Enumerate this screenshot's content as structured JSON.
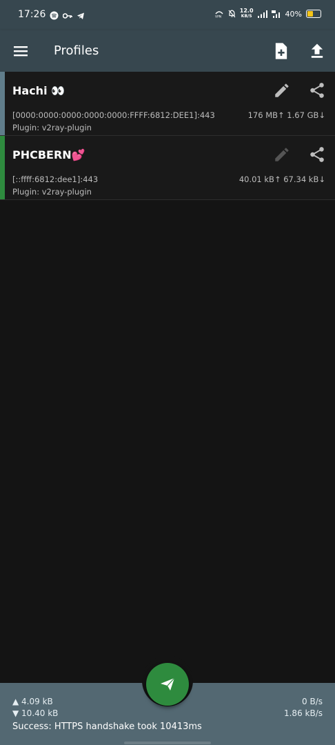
{
  "status_bar": {
    "time": "17:26",
    "net_speed_value": "12.0",
    "net_speed_unit": "KB/S",
    "battery": "40%",
    "battery_level": 0.4
  },
  "toolbar": {
    "title": "Profiles"
  },
  "profiles": [
    {
      "name": "Hachi 👀",
      "address": "[0000:0000:0000:0000:0000:FFFF:6812:DEE1]:443",
      "plugin": "Plugin: v2ray-plugin",
      "traffic": "176 MB↑ 1.67 GB↓",
      "accent": "#607d8b"
    },
    {
      "name": "PHCBERN💕",
      "address": "[::ffff:6812:dee1]:443",
      "plugin": "Plugin: v2ray-plugin",
      "traffic": "40.01 kB↑   67.34 kB↓",
      "accent": "#2e8b3e"
    }
  ],
  "bottom": {
    "upload_total": "▲ 4.09 kB",
    "download_total": "▼ 10.40 kB",
    "upload_rate": "0 B/s",
    "download_rate": "1.86 kB/s",
    "status": "Success: HTTPS handshake took 10413ms"
  },
  "colors": {
    "toolbar": "#37474f",
    "bottom_bar": "#536872",
    "fab": "#2e8b3e",
    "background": "#141414"
  }
}
